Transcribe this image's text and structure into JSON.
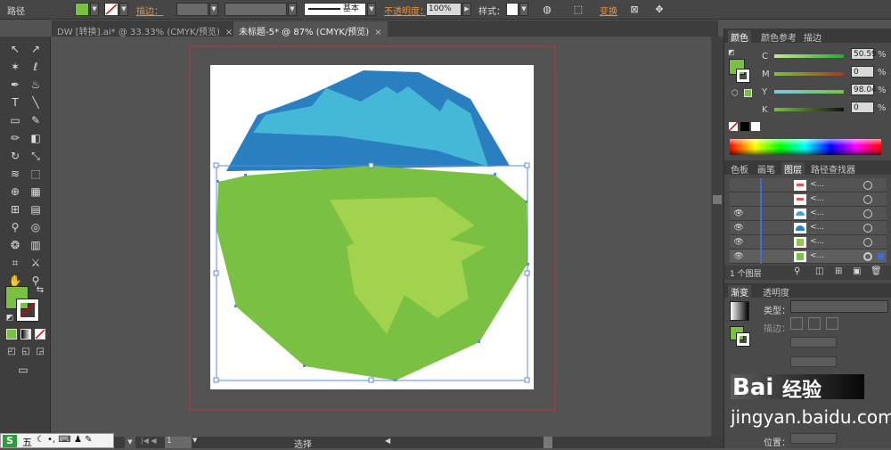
{
  "control_bar": {
    "path_label": "路径",
    "stroke_label": "描边：",
    "stroke_style": "基本",
    "opacity_label": "不透明度：",
    "opacity_value": "100%",
    "style_label": "样式：",
    "transform_label": "变换",
    "fill_color": "#7ac143"
  },
  "tabs": [
    {
      "label": "DW [转换].ai* @ 33.33% (CMYK/预览)",
      "close": "×"
    },
    {
      "label": "未标题-5* @ 87% (CMYK/预览)",
      "close": "×"
    }
  ],
  "color_panel": {
    "tabs": [
      "颜色",
      "颜色参考",
      "描边"
    ],
    "channels": [
      {
        "name": "C",
        "value": "50.59",
        "unit": "%"
      },
      {
        "name": "M",
        "value": "0",
        "unit": "%"
      },
      {
        "name": "Y",
        "value": "98.04",
        "unit": "%"
      },
      {
        "name": "K",
        "value": "0",
        "unit": "%"
      }
    ],
    "current_color": "#7ac143"
  },
  "layers_panel": {
    "tabs": [
      "色板",
      "画笔",
      "图层",
      "路径查找器"
    ],
    "rows": [
      {
        "name": "<...",
        "visible": false,
        "thumb_color": "#e05050"
      },
      {
        "name": "<...",
        "visible": false,
        "thumb_color": "#e05050"
      },
      {
        "name": "<...",
        "visible": true,
        "thumb_color": "#3aa7d5"
      },
      {
        "name": "<...",
        "visible": true,
        "thumb_color": "#2a7fc0"
      },
      {
        "name": "<...",
        "visible": true,
        "thumb_color": "#8fc843"
      },
      {
        "name": "<...",
        "visible": true,
        "thumb_color": "#7ac143"
      }
    ],
    "footer": "1 个图层"
  },
  "gradient_panel": {
    "tabs": [
      "渐变",
      "透明度"
    ],
    "type_label": "类型：",
    "stroke_label": "描边：",
    "position_label": "位置："
  },
  "status_bar": {
    "zoom": "87%",
    "page": "1",
    "mode": "选择"
  },
  "watermark": {
    "brand": "Bai",
    "product": "经验",
    "url": "jingyan.baidu.com"
  },
  "ime_bar": {
    "label": "五"
  }
}
